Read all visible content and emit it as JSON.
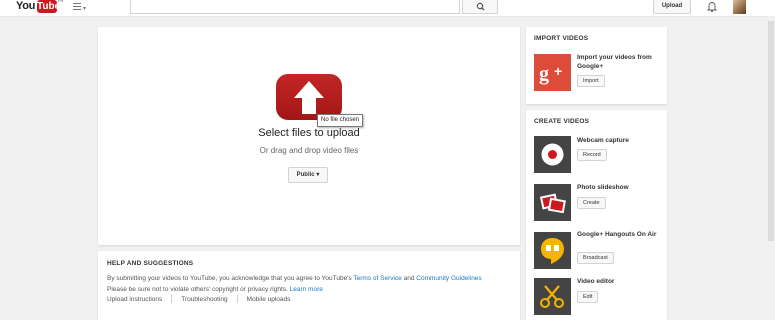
{
  "header": {
    "logo_you": "You",
    "logo_tube": "Tube",
    "logo_region": "IN",
    "guide_icon": "hamburger-menu-icon",
    "search_placeholder": "",
    "search_icon": "search-icon",
    "upload_label": "Upload",
    "notification_icon": "bell-icon",
    "avatar": "user-avatar"
  },
  "upload": {
    "tooltip": "No file chosen",
    "title": "Select files to upload",
    "subtitle": "Or drag and drop video files",
    "privacy_label": "Public"
  },
  "help": {
    "heading": "HELP AND SUGGESTIONS",
    "text_1": "By submitting your videos to YouTube, you acknowledge that you agree to YouTube's",
    "terms_link": "Terms of Service",
    "text_and": "and",
    "guidelines_link": "Community Guidelines",
    "text_2": "Please be sure not to violate others' copyright or privacy rights.",
    "learn_more": "Learn more",
    "links": [
      "Upload instructions",
      "Troubleshooting",
      "Mobile uploads"
    ]
  },
  "import": {
    "heading": "IMPORT VIDEOS",
    "gplus_title": "Import your videos from Google+",
    "gplus_button": "Import"
  },
  "create": {
    "heading": "CREATE VIDEOS",
    "items": [
      {
        "title": "Webcam capture",
        "button": "Record",
        "icon": "webcam-icon"
      },
      {
        "title": "Photo slideshow",
        "button": "Create",
        "icon": "photos-icon"
      },
      {
        "title": "Google+ Hangouts On Air",
        "button": "Broadcast",
        "icon": "hangouts-icon"
      },
      {
        "title": "Video editor",
        "button": "Edit",
        "icon": "scissors-icon"
      }
    ]
  },
  "colors": {
    "brand_red": "#cc181e",
    "link_blue": "#167ac6",
    "gplus_red": "#dd4b39",
    "hangouts_yellow": "#f4b400"
  }
}
